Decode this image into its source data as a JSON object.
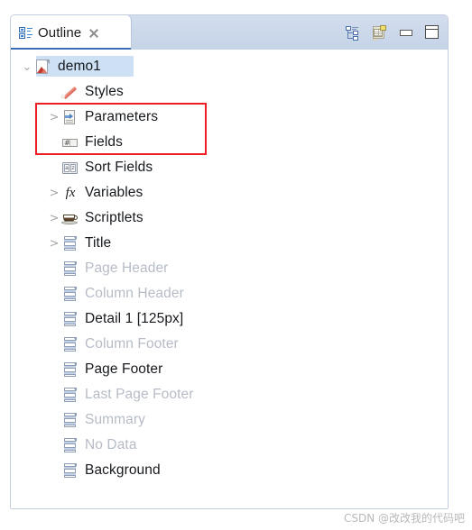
{
  "view": {
    "tab": {
      "label": "Outline",
      "icon": "outline-icon",
      "close_icon": "close-icon",
      "active": true
    },
    "toolbar": [
      {
        "name": "collapse-all-icon",
        "title": "Collapse All"
      },
      {
        "name": "report-properties-icon",
        "title": "Report Properties"
      },
      {
        "name": "minimize-icon",
        "title": "Minimize"
      },
      {
        "name": "maximize-icon",
        "title": "Maximize"
      }
    ]
  },
  "colors": {
    "tab_underline": "#3a6fb5",
    "selection": "#cde0f4",
    "highlight_rect": "#ee1c23",
    "disabled_text": "#b6bcc6",
    "text": "#16191d",
    "header_bar": "#cbd8ea"
  },
  "tree": {
    "items": [
      {
        "label": "demo1",
        "icon": "report-icon",
        "indent": 0,
        "twisty": "⌄",
        "expanded": true,
        "selected": true,
        "disabled": false
      },
      {
        "label": "Styles",
        "icon": "pencil-icon",
        "indent": 1,
        "twisty": "",
        "expanded": false,
        "selected": false,
        "disabled": false
      },
      {
        "label": "Parameters",
        "icon": "parameter-icon",
        "indent": 1,
        "twisty": ">",
        "expanded": false,
        "selected": false,
        "disabled": false
      },
      {
        "label": "Fields",
        "icon": "fields-icon",
        "indent": 1,
        "twisty": "",
        "expanded": false,
        "selected": false,
        "disabled": false
      },
      {
        "label": "Sort Fields",
        "icon": "sort-fields-icon",
        "indent": 1,
        "twisty": "",
        "expanded": false,
        "selected": false,
        "disabled": false
      },
      {
        "label": "Variables",
        "icon": "fx-icon",
        "indent": 1,
        "twisty": ">",
        "expanded": false,
        "selected": false,
        "disabled": false
      },
      {
        "label": "Scriptlets",
        "icon": "coffee-icon",
        "indent": 1,
        "twisty": ">",
        "expanded": false,
        "selected": false,
        "disabled": false
      },
      {
        "label": "Title",
        "icon": "band-icon",
        "indent": 1,
        "twisty": ">",
        "expanded": false,
        "selected": false,
        "disabled": false
      },
      {
        "label": "Page Header",
        "icon": "band-icon",
        "indent": 1,
        "twisty": "",
        "expanded": false,
        "selected": false,
        "disabled": true
      },
      {
        "label": "Column Header",
        "icon": "band-icon",
        "indent": 1,
        "twisty": "",
        "expanded": false,
        "selected": false,
        "disabled": true
      },
      {
        "label": "Detail 1 [125px]",
        "icon": "band-icon",
        "indent": 1,
        "twisty": "",
        "expanded": false,
        "selected": false,
        "disabled": false
      },
      {
        "label": "Column Footer",
        "icon": "band-icon",
        "indent": 1,
        "twisty": "",
        "expanded": false,
        "selected": false,
        "disabled": true
      },
      {
        "label": "Page Footer",
        "icon": "band-icon",
        "indent": 1,
        "twisty": "",
        "expanded": false,
        "selected": false,
        "disabled": false
      },
      {
        "label": "Last Page Footer",
        "icon": "band-icon",
        "indent": 1,
        "twisty": "",
        "expanded": false,
        "selected": false,
        "disabled": true
      },
      {
        "label": "Summary",
        "icon": "band-icon",
        "indent": 1,
        "twisty": "",
        "expanded": false,
        "selected": false,
        "disabled": true
      },
      {
        "label": "No Data",
        "icon": "band-icon",
        "indent": 1,
        "twisty": "",
        "expanded": false,
        "selected": false,
        "disabled": true
      },
      {
        "label": "Background",
        "icon": "band-icon",
        "indent": 1,
        "twisty": "",
        "expanded": false,
        "selected": false,
        "disabled": false
      }
    ]
  },
  "annotation": {
    "type": "rectangle",
    "color": "#ee1c23",
    "covers": [
      "Parameters",
      "Fields"
    ]
  },
  "watermark": {
    "text": "CSDN @改改我的代码吧"
  }
}
